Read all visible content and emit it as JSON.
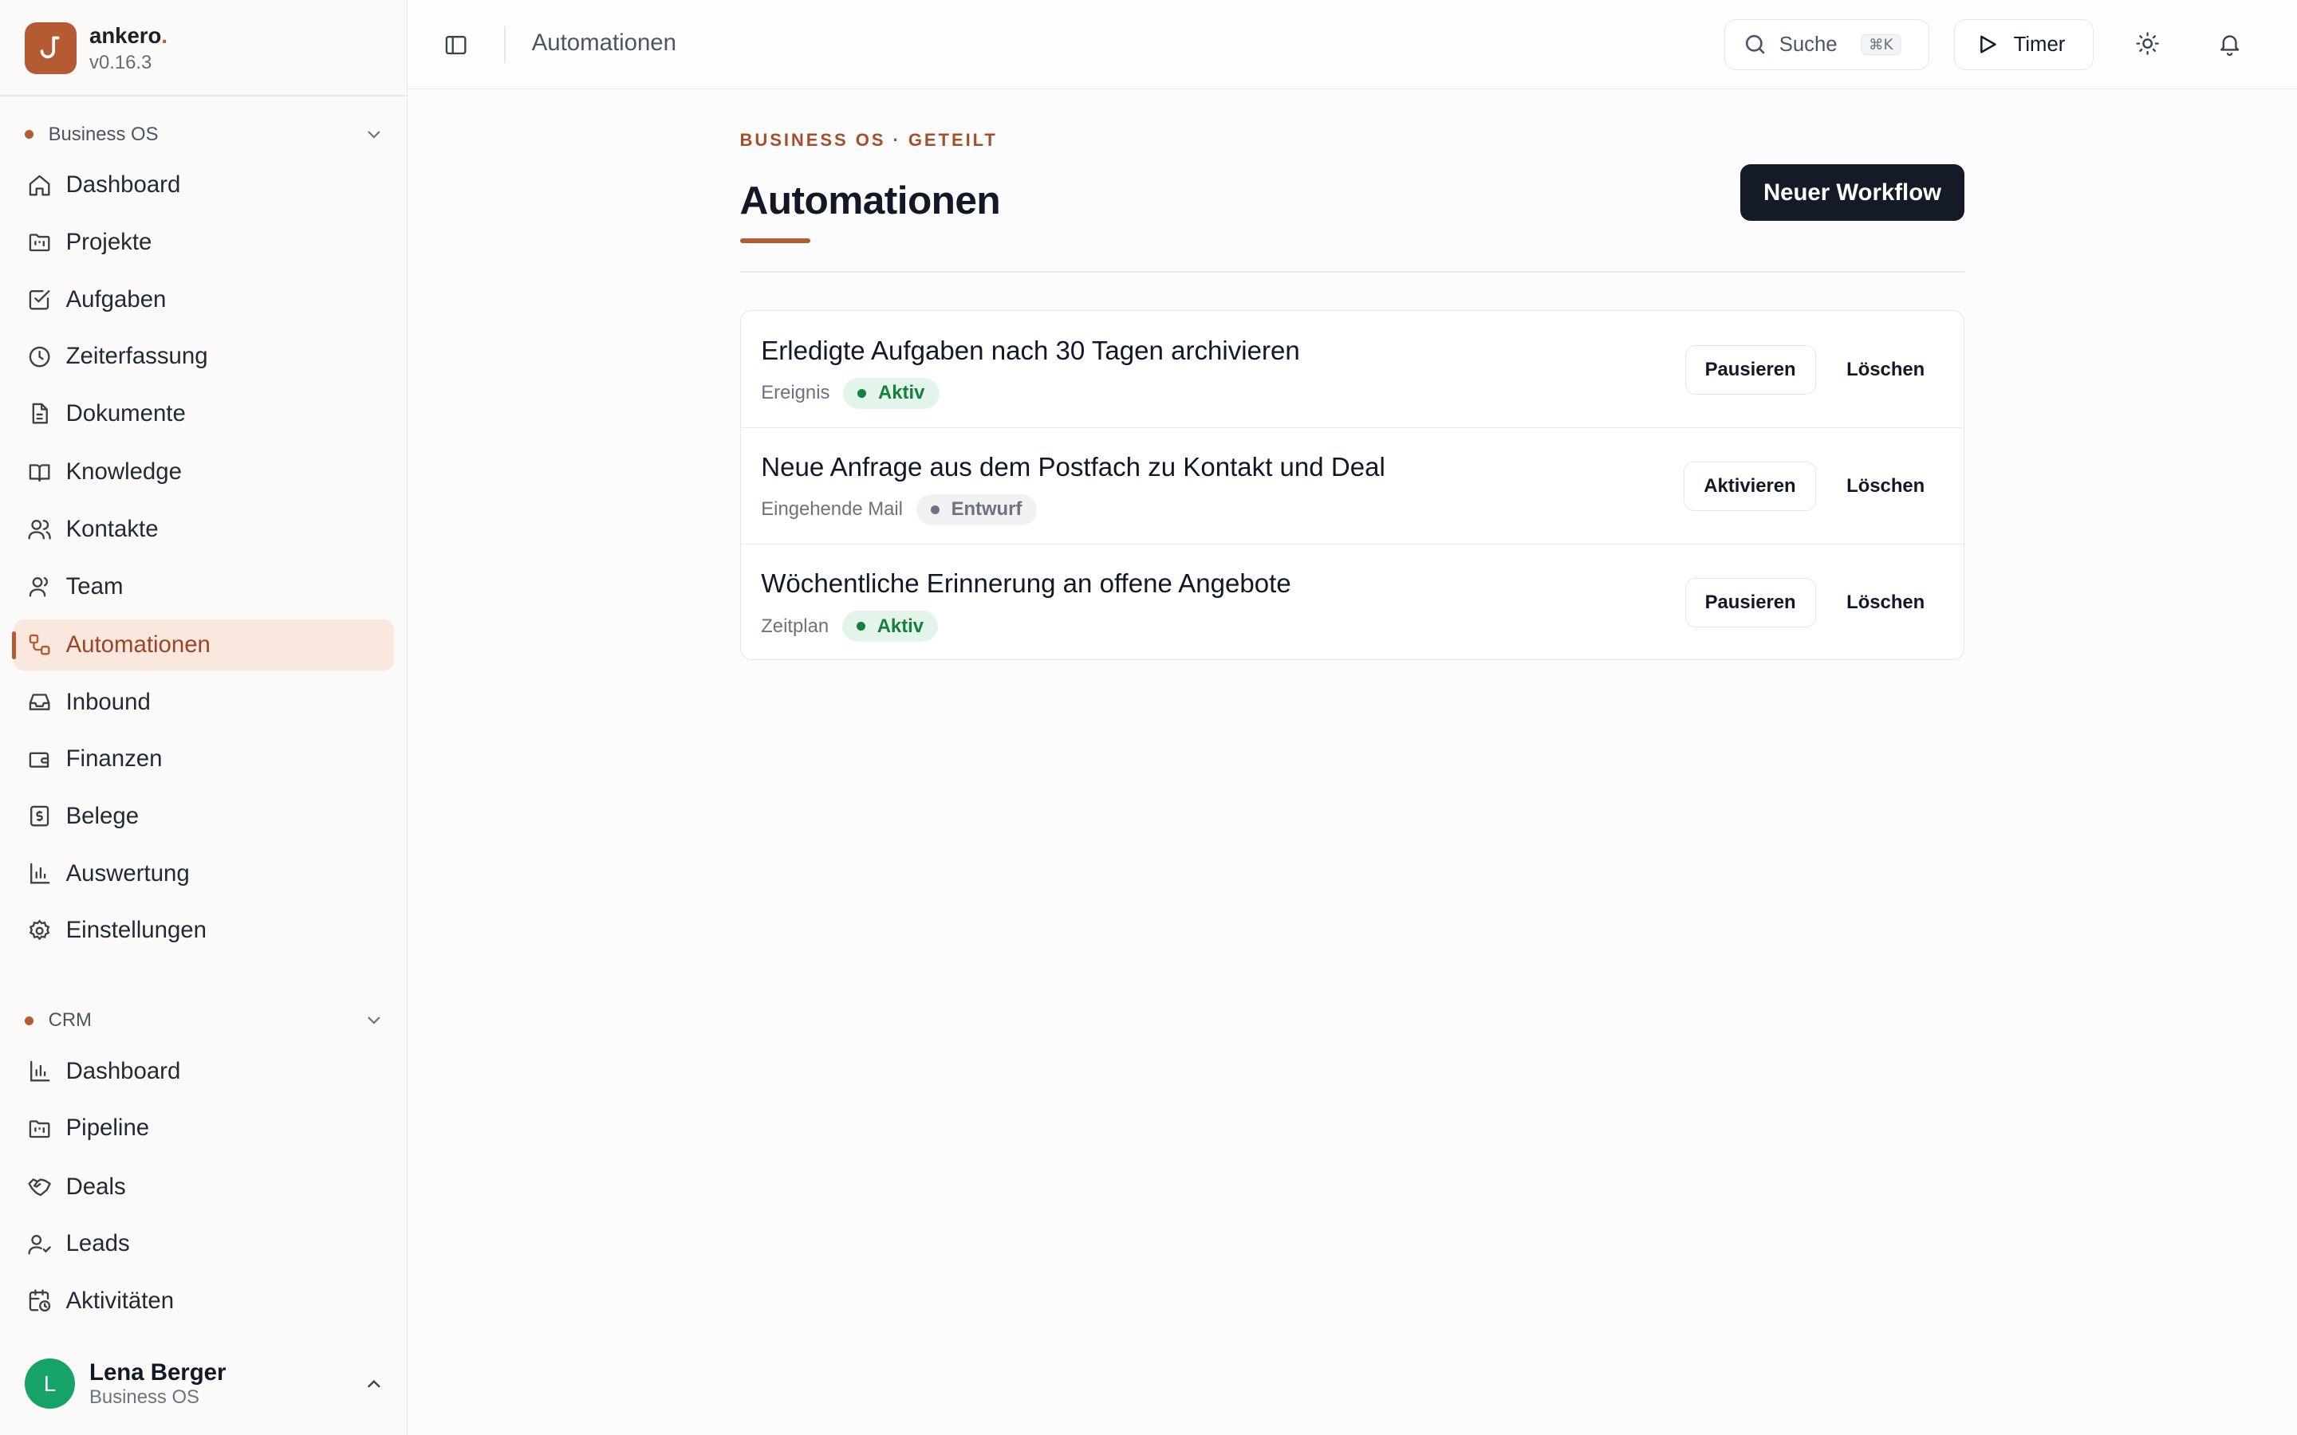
{
  "brand": {
    "name": "ankero",
    "dot": ".",
    "version": "v0.16.3",
    "logo_glyph": "ȷ"
  },
  "sidebar": {
    "sections": [
      {
        "title": "Business OS",
        "items": [
          {
            "label": "Dashboard",
            "icon": "home-icon"
          },
          {
            "label": "Projekte",
            "icon": "folder-kanban-icon"
          },
          {
            "label": "Aufgaben",
            "icon": "checkbox-icon"
          },
          {
            "label": "Zeiterfassung",
            "icon": "clock-icon"
          },
          {
            "label": "Dokumente",
            "icon": "file-text-icon"
          },
          {
            "label": "Knowledge",
            "icon": "book-icon"
          },
          {
            "label": "Kontakte",
            "icon": "users-icon"
          },
          {
            "label": "Team",
            "icon": "user-icon"
          },
          {
            "label": "Automationen",
            "icon": "workflow-icon",
            "active": true
          },
          {
            "label": "Inbound",
            "icon": "inbox-icon"
          },
          {
            "label": "Finanzen",
            "icon": "wallet-icon"
          },
          {
            "label": "Belege",
            "icon": "receipt-icon"
          },
          {
            "label": "Auswertung",
            "icon": "bar-chart-icon"
          },
          {
            "label": "Einstellungen",
            "icon": "gear-icon"
          }
        ]
      },
      {
        "title": "CRM",
        "items": [
          {
            "label": "Dashboard",
            "icon": "bar-chart-icon"
          },
          {
            "label": "Pipeline",
            "icon": "folder-kanban-icon"
          },
          {
            "label": "Deals",
            "icon": "handshake-icon"
          },
          {
            "label": "Leads",
            "icon": "user-check-icon"
          },
          {
            "label": "Aktivitäten",
            "icon": "calendar-clock-icon"
          }
        ]
      }
    ]
  },
  "user": {
    "initial": "L",
    "name": "Lena Berger",
    "workspace": "Business OS"
  },
  "topbar": {
    "title": "Automationen",
    "search_label": "Suche",
    "search_shortcut": "⌘K",
    "timer_label": "Timer"
  },
  "page": {
    "eyebrow": "BUSINESS OS · GETEILT",
    "title": "Automationen",
    "new_button": "Neuer Workflow"
  },
  "workflows": [
    {
      "name": "Erledigte Aufgaben nach 30 Tagen archivieren",
      "trigger": "Ereignis",
      "status": "Aktiv",
      "action": "Pausieren",
      "delete": "Löschen"
    },
    {
      "name": "Neue Anfrage aus dem Postfach zu Kontakt und Deal",
      "trigger": "Eingehende Mail",
      "status": "Entwurf",
      "action": "Aktivieren",
      "delete": "Löschen"
    },
    {
      "name": "Wöchentliche Erinnerung an offene Angebote",
      "trigger": "Zeitplan",
      "status": "Aktiv",
      "action": "Pausieren",
      "delete": "Löschen"
    }
  ],
  "colors": {
    "accent": "#b45b33",
    "primary_button": "#151a28",
    "active_badge": "#15803d",
    "avatar": "#16a36a"
  }
}
